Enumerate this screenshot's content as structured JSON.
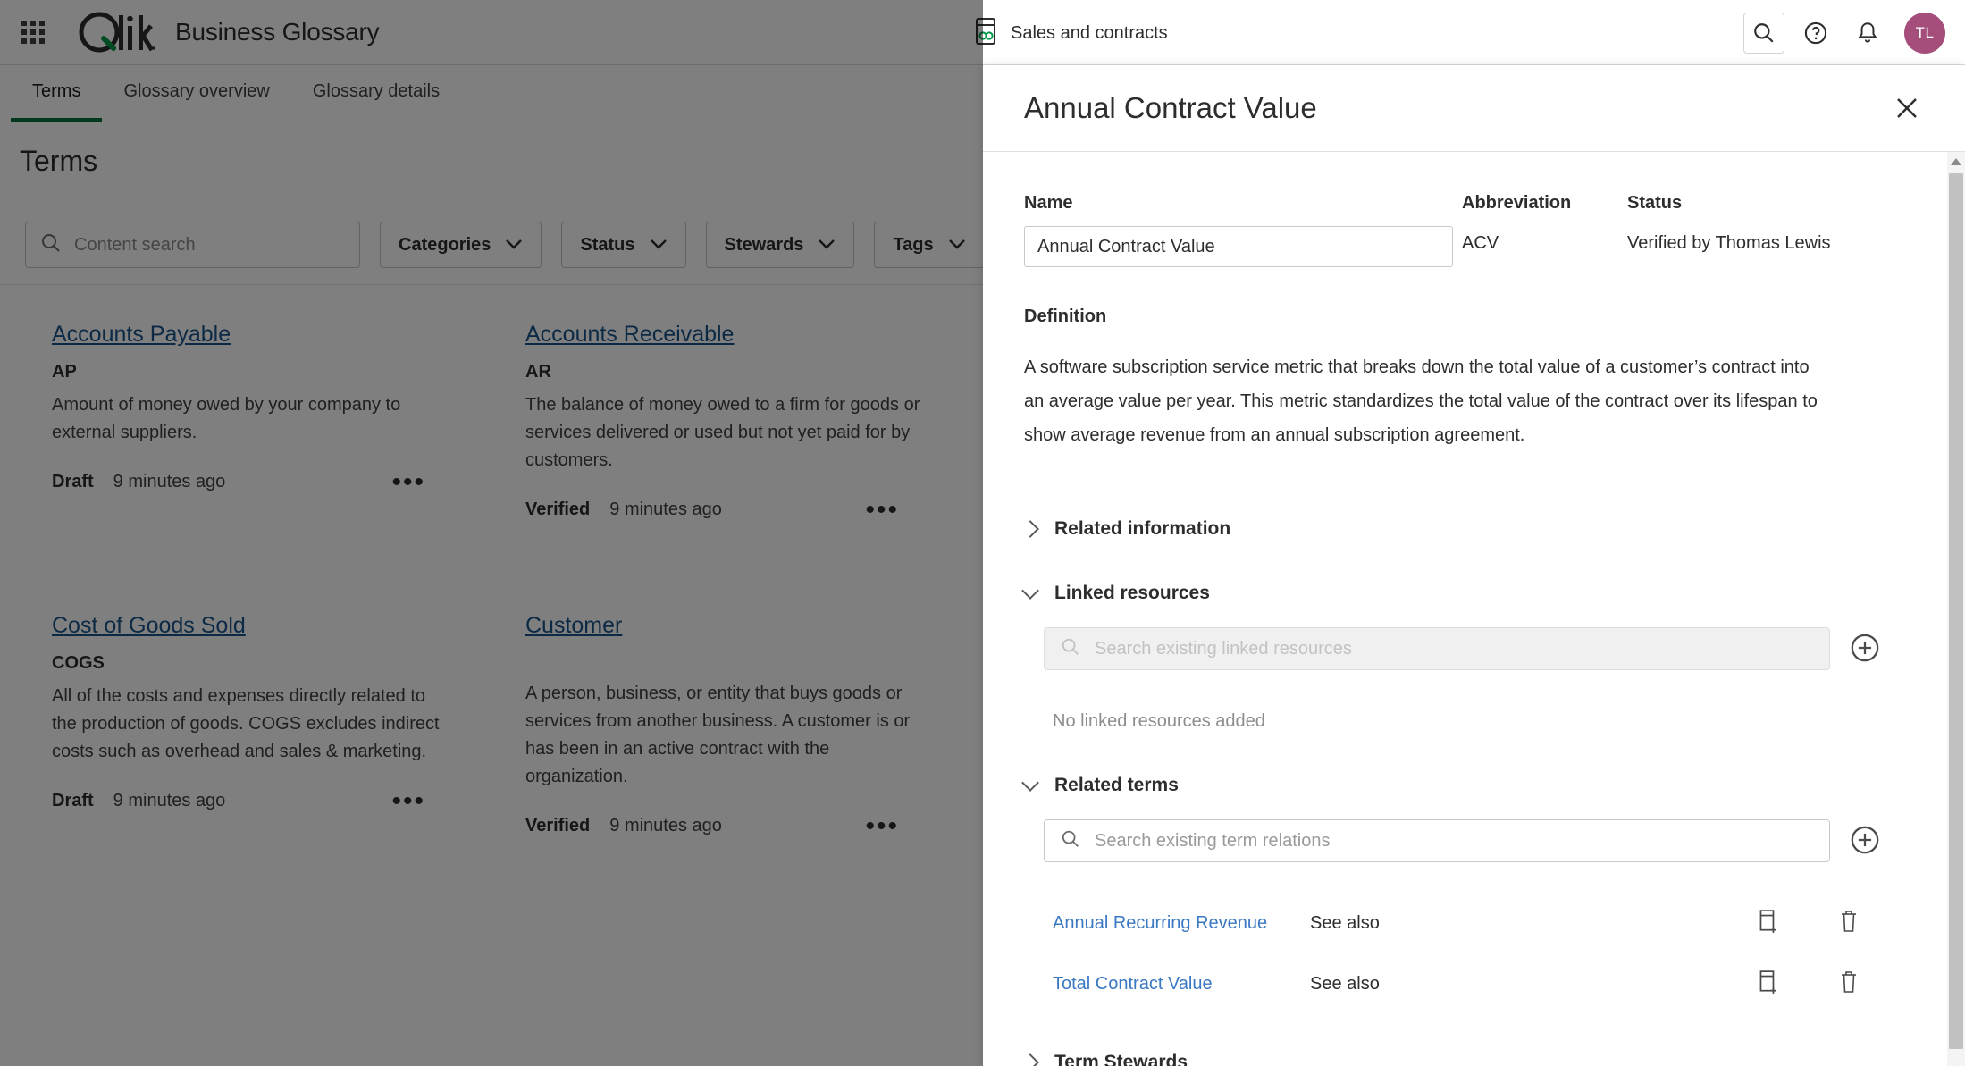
{
  "topbar": {
    "app_title": "Business Glossary",
    "logo_text": "Qlik",
    "space_name": "Sales and contracts",
    "waffle_icon": "grid-apps-icon",
    "glossary_icon": "glossary-book-icon",
    "search_icon": "search-icon",
    "help_icon": "help-circle-icon",
    "notification_icon": "bell-icon",
    "avatar_initials": "TL",
    "avatar_color": "#a54e7b"
  },
  "tabs": [
    {
      "label": "Terms",
      "active": true
    },
    {
      "label": "Glossary overview",
      "active": false
    },
    {
      "label": "Glossary details",
      "active": false
    }
  ],
  "page": {
    "title": "Terms",
    "accent_color": "#00703c"
  },
  "filters": {
    "search_placeholder": "Content search",
    "search_value": "",
    "search_icon": "search-icon",
    "chips": [
      {
        "label": "Categories",
        "icon": "chevron-down-icon"
      },
      {
        "label": "Status",
        "icon": "chevron-down-icon"
      },
      {
        "label": "Stewards",
        "icon": "chevron-down-icon"
      },
      {
        "label": "Tags",
        "icon": "chevron-down-icon"
      }
    ],
    "filter_icon": "funnel-filter-icon"
  },
  "terms": [
    {
      "name": "Accounts Payable",
      "abbreviation": "AP",
      "description": "Amount of money owed by your company to external suppliers.",
      "status": "Draft",
      "updated": "9 minutes ago",
      "more_icon": "ellipsis-icon"
    },
    {
      "name": "Accounts Receivable",
      "abbreviation": "AR",
      "description": "The balance of money owed to a firm for goods or services delivered or used but not yet paid for by customers.",
      "status": "Verified",
      "updated": "9 minutes ago",
      "more_icon": "ellipsis-icon"
    },
    {
      "name": "Cost of Goods Sold",
      "abbreviation": "COGS",
      "description": "All of the costs and expenses directly related to the production of goods. COGS excludes indirect costs such as overhead and sales & marketing.",
      "status": "Draft",
      "updated": "9 minutes ago",
      "more_icon": "ellipsis-icon"
    },
    {
      "name": "Customer",
      "abbreviation": "",
      "description": "A person, business, or entity that buys goods or services from another business. A customer is or has been in an active contract with the organization.",
      "status": "Verified",
      "updated": "9 minutes ago",
      "more_icon": "ellipsis-icon"
    }
  ],
  "panel": {
    "title": "Annual Contract Value",
    "close_icon": "close-icon",
    "name_label": "Name",
    "name_value": "Annual Contract Value",
    "abbreviation_label": "Abbreviation",
    "abbreviation_value": "ACV",
    "status_label": "Status",
    "status_value": "Verified by Thomas Lewis",
    "definition_label": "Definition",
    "definition_text": "A software subscription service metric that breaks down the total value of a customer’s contract into an average value per year. This metric standardizes  the total value of the contract over its lifespan to show average revenue from an annual subscription agreement.",
    "sections": {
      "related_information": {
        "title": "Related information",
        "expanded": false,
        "caret_icon": "chevron-right-icon"
      },
      "linked_resources": {
        "title": "Linked resources",
        "expanded": true,
        "caret_icon": "chevron-down-icon",
        "search_placeholder": "Search existing linked resources",
        "search_value": "",
        "search_icon": "search-icon",
        "add_icon": "plus-circle-icon",
        "empty_text": "No linked resources added"
      },
      "related_terms": {
        "title": "Related terms",
        "expanded": true,
        "caret_icon": "chevron-down-icon",
        "search_placeholder": "Search existing term relations",
        "search_value": "",
        "search_icon": "search-icon",
        "add_icon": "plus-circle-icon",
        "rows": [
          {
            "name": "Annual Recurring Revenue",
            "relation": "See also",
            "add_icon": "add-to-list-icon",
            "delete_icon": "trash-icon"
          },
          {
            "name": "Total Contract Value",
            "relation": "See also",
            "add_icon": "add-to-list-icon",
            "delete_icon": "trash-icon"
          }
        ]
      },
      "term_stewards": {
        "title": "Term Stewards",
        "expanded": false,
        "caret_icon": "chevron-right-icon"
      }
    }
  }
}
